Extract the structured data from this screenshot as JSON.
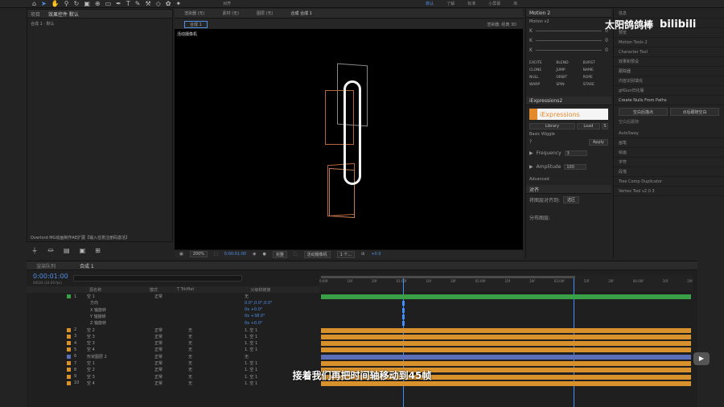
{
  "toolbar": {
    "snap": "对齐",
    "workspaces": [
      "默认",
      "了解",
      "标准",
      "小屏幕",
      "库"
    ],
    "search_placeholder": ""
  },
  "left_panel": {
    "tabs": [
      "项目",
      "效果控件 默认"
    ],
    "comp_label": "合成 1 · 默认",
    "effect_name": "Overlord MG动画制作AE扩展【输入任意注册码激活】"
  },
  "viewer": {
    "tabs": [
      "渲染器 (无)",
      "素材 (无)",
      "图层 (无)",
      "合成 合成 1"
    ],
    "sub_tab": "合成 1",
    "camera_label": "活动摄像机",
    "renderer": "渲染器: 经典 3D",
    "zoom": "200%",
    "timecode": "0:00:01:00",
    "quality": "完整",
    "view": "活动摄像机",
    "views": "1 个...",
    "offset": "+0.0"
  },
  "motion2": {
    "title": "Motion 2",
    "version": "Motion v2",
    "rows": [
      "0",
      "0",
      "0"
    ],
    "buttons": [
      "EXCITE",
      "BLEND",
      "BURST",
      "CLONE",
      "JUMP",
      "NAME",
      "NULL",
      "ORBIT",
      "ROPE",
      "WARP",
      "SPIN",
      "STARE"
    ],
    "tab2": "iExpressions2"
  },
  "iexp": {
    "title": "iExpressions",
    "tabs": [
      "Library",
      "Load",
      "S"
    ],
    "section": "Basic Wiggle",
    "apply": "Apply",
    "freq_label": "Frequency",
    "freq": "3",
    "amp_label": "Amplitude",
    "amp": "100",
    "advanced": "Advanced"
  },
  "align": {
    "title": "对齐",
    "align_to": "将图层对齐到:",
    "align_to_val": "选区",
    "distribute": "分布图层:"
  },
  "right_panel": {
    "items": [
      "信息",
      "音频",
      "预览",
      "Motion Tools 2",
      "Character Tool",
      "效果和预设",
      "跟踪器",
      "内容识别填充",
      "gifGun日化版",
      "Create Nulls From Paths",
      "AutoSway",
      "画笔",
      "绘画",
      "字符",
      "段落",
      "Tree Comp Duplicator",
      "Vertex Tool v2.0.3"
    ],
    "btn_a": "空白后描点",
    "btn_b": "点后跟随空白",
    "footer": "空白后跟随"
  },
  "watermark": {
    "text": "太阳鸽鸽棒",
    "brand": "bilibili"
  },
  "timeline": {
    "tabs": [
      "渲染队列",
      "合成 1"
    ],
    "timecode": "0:00:01:00",
    "frames": "00024 (24.00 fps)",
    "search_placeholder": "",
    "columns": [
      "源名称",
      "模式",
      "T TrkMat",
      "父级和链接"
    ],
    "ruler": [
      "0:00f",
      "10f",
      "20f",
      "01:00f",
      "10f",
      "20f",
      "02:00f",
      "10f",
      "20f",
      "03:00f",
      "10f",
      "20f",
      "04:00f",
      "10f",
      "20f"
    ],
    "layers": [
      {
        "num": "1",
        "name": "空 1",
        "mode": "正常",
        "trk": "",
        "parent": "无",
        "color": "#3aa047"
      },
      {
        "num": "",
        "name": "方向",
        "mode": "",
        "trk": "",
        "parent": "0.0°,0.0°,0.0°",
        "color": ""
      },
      {
        "num": "",
        "name": "X 轴旋转",
        "mode": "",
        "trk": "",
        "parent": "0x +0.0°",
        "color": ""
      },
      {
        "num": "",
        "name": "Y 轴旋转",
        "mode": "",
        "trk": "",
        "parent": "0x +38.0°",
        "color": ""
      },
      {
        "num": "",
        "name": "Z 轴旋转",
        "mode": "",
        "trk": "",
        "parent": "0x +0.0°",
        "color": ""
      },
      {
        "num": "2",
        "name": "空 2",
        "mode": "正常",
        "trk": "无",
        "parent": "1. 空 1",
        "color": "#d9922b"
      },
      {
        "num": "3",
        "name": "空 3",
        "mode": "正常",
        "trk": "无",
        "parent": "1. 空 1",
        "color": "#d9922b"
      },
      {
        "num": "4",
        "name": "空 3",
        "mode": "正常",
        "trk": "无",
        "parent": "1. 空 1",
        "color": "#d9922b"
      },
      {
        "num": "5",
        "name": "空 4",
        "mode": "正常",
        "trk": "无",
        "parent": "1. 空 1",
        "color": "#d9922b"
      },
      {
        "num": "6",
        "name": "形状图层 2",
        "mode": "正常",
        "trk": "无",
        "parent": "无",
        "color": "#5a6fb8"
      },
      {
        "num": "7",
        "name": "空 1",
        "mode": "正常",
        "trk": "无",
        "parent": "1. 空 1",
        "color": "#d9922b"
      },
      {
        "num": "8",
        "name": "空 2",
        "mode": "正常",
        "trk": "无",
        "parent": "1. 空 1",
        "color": "#d9922b"
      },
      {
        "num": "9",
        "name": "空 3",
        "mode": "正常",
        "trk": "无",
        "parent": "1. 空 1",
        "color": "#d9922b"
      },
      {
        "num": "10",
        "name": "空 4",
        "mode": "正常",
        "trk": "无",
        "parent": "1. 空 1",
        "color": "#d9922b"
      }
    ]
  },
  "subtitle": "接着我们再把时间轴移动到45帧"
}
